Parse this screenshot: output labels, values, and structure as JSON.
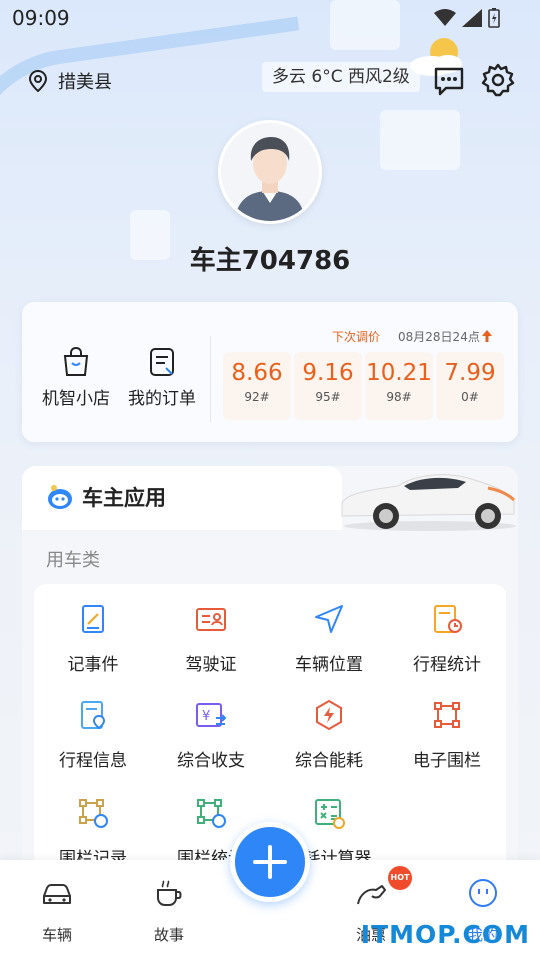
{
  "status_bar": {
    "time": "09:09"
  },
  "header": {
    "location": "措美县",
    "weather": "多云 6°C 西风2级"
  },
  "profile": {
    "username": "车主704786"
  },
  "shortcuts": [
    {
      "label": "机智小店"
    },
    {
      "label": "我的订单"
    }
  ],
  "fuel_price": {
    "next_adjust_label": "下次调价",
    "next_adjust_date": "08月28日24点",
    "prices": [
      {
        "value": "8.66",
        "type": "92#"
      },
      {
        "value": "9.16",
        "type": "95#"
      },
      {
        "value": "10.21",
        "type": "98#"
      },
      {
        "value": "7.99",
        "type": "0#"
      }
    ]
  },
  "apps": {
    "title": "车主应用",
    "category": "用车类",
    "items": [
      {
        "label": "记事件",
        "icon": "edit-note-icon"
      },
      {
        "label": "驾驶证",
        "icon": "license-card-icon"
      },
      {
        "label": "车辆位置",
        "icon": "navigation-icon"
      },
      {
        "label": "行程统计",
        "icon": "trip-stats-icon"
      },
      {
        "label": "行程信息",
        "icon": "trip-info-icon"
      },
      {
        "label": "综合收支",
        "icon": "income-expense-icon"
      },
      {
        "label": "综合能耗",
        "icon": "energy-icon"
      },
      {
        "label": "电子围栏",
        "icon": "fence-icon"
      },
      {
        "label": "围栏记录",
        "icon": "fence-record-icon"
      },
      {
        "label": "围栏统计",
        "icon": "fence-stats-icon"
      },
      {
        "label": "油耗计算器",
        "icon": "calculator-icon"
      }
    ]
  },
  "bottom_nav": [
    {
      "label": "车辆",
      "icon": "car-icon"
    },
    {
      "label": "故事",
      "icon": "coffee-icon"
    },
    {
      "label": "油惠",
      "icon": "fuel-nozzle-icon",
      "badge": "HOT"
    },
    {
      "label": "我的",
      "icon": "smiley-icon"
    }
  ],
  "watermark": "ITMOP.COM",
  "colors": {
    "accent": "#2f86f6",
    "price": "#e8601b"
  }
}
